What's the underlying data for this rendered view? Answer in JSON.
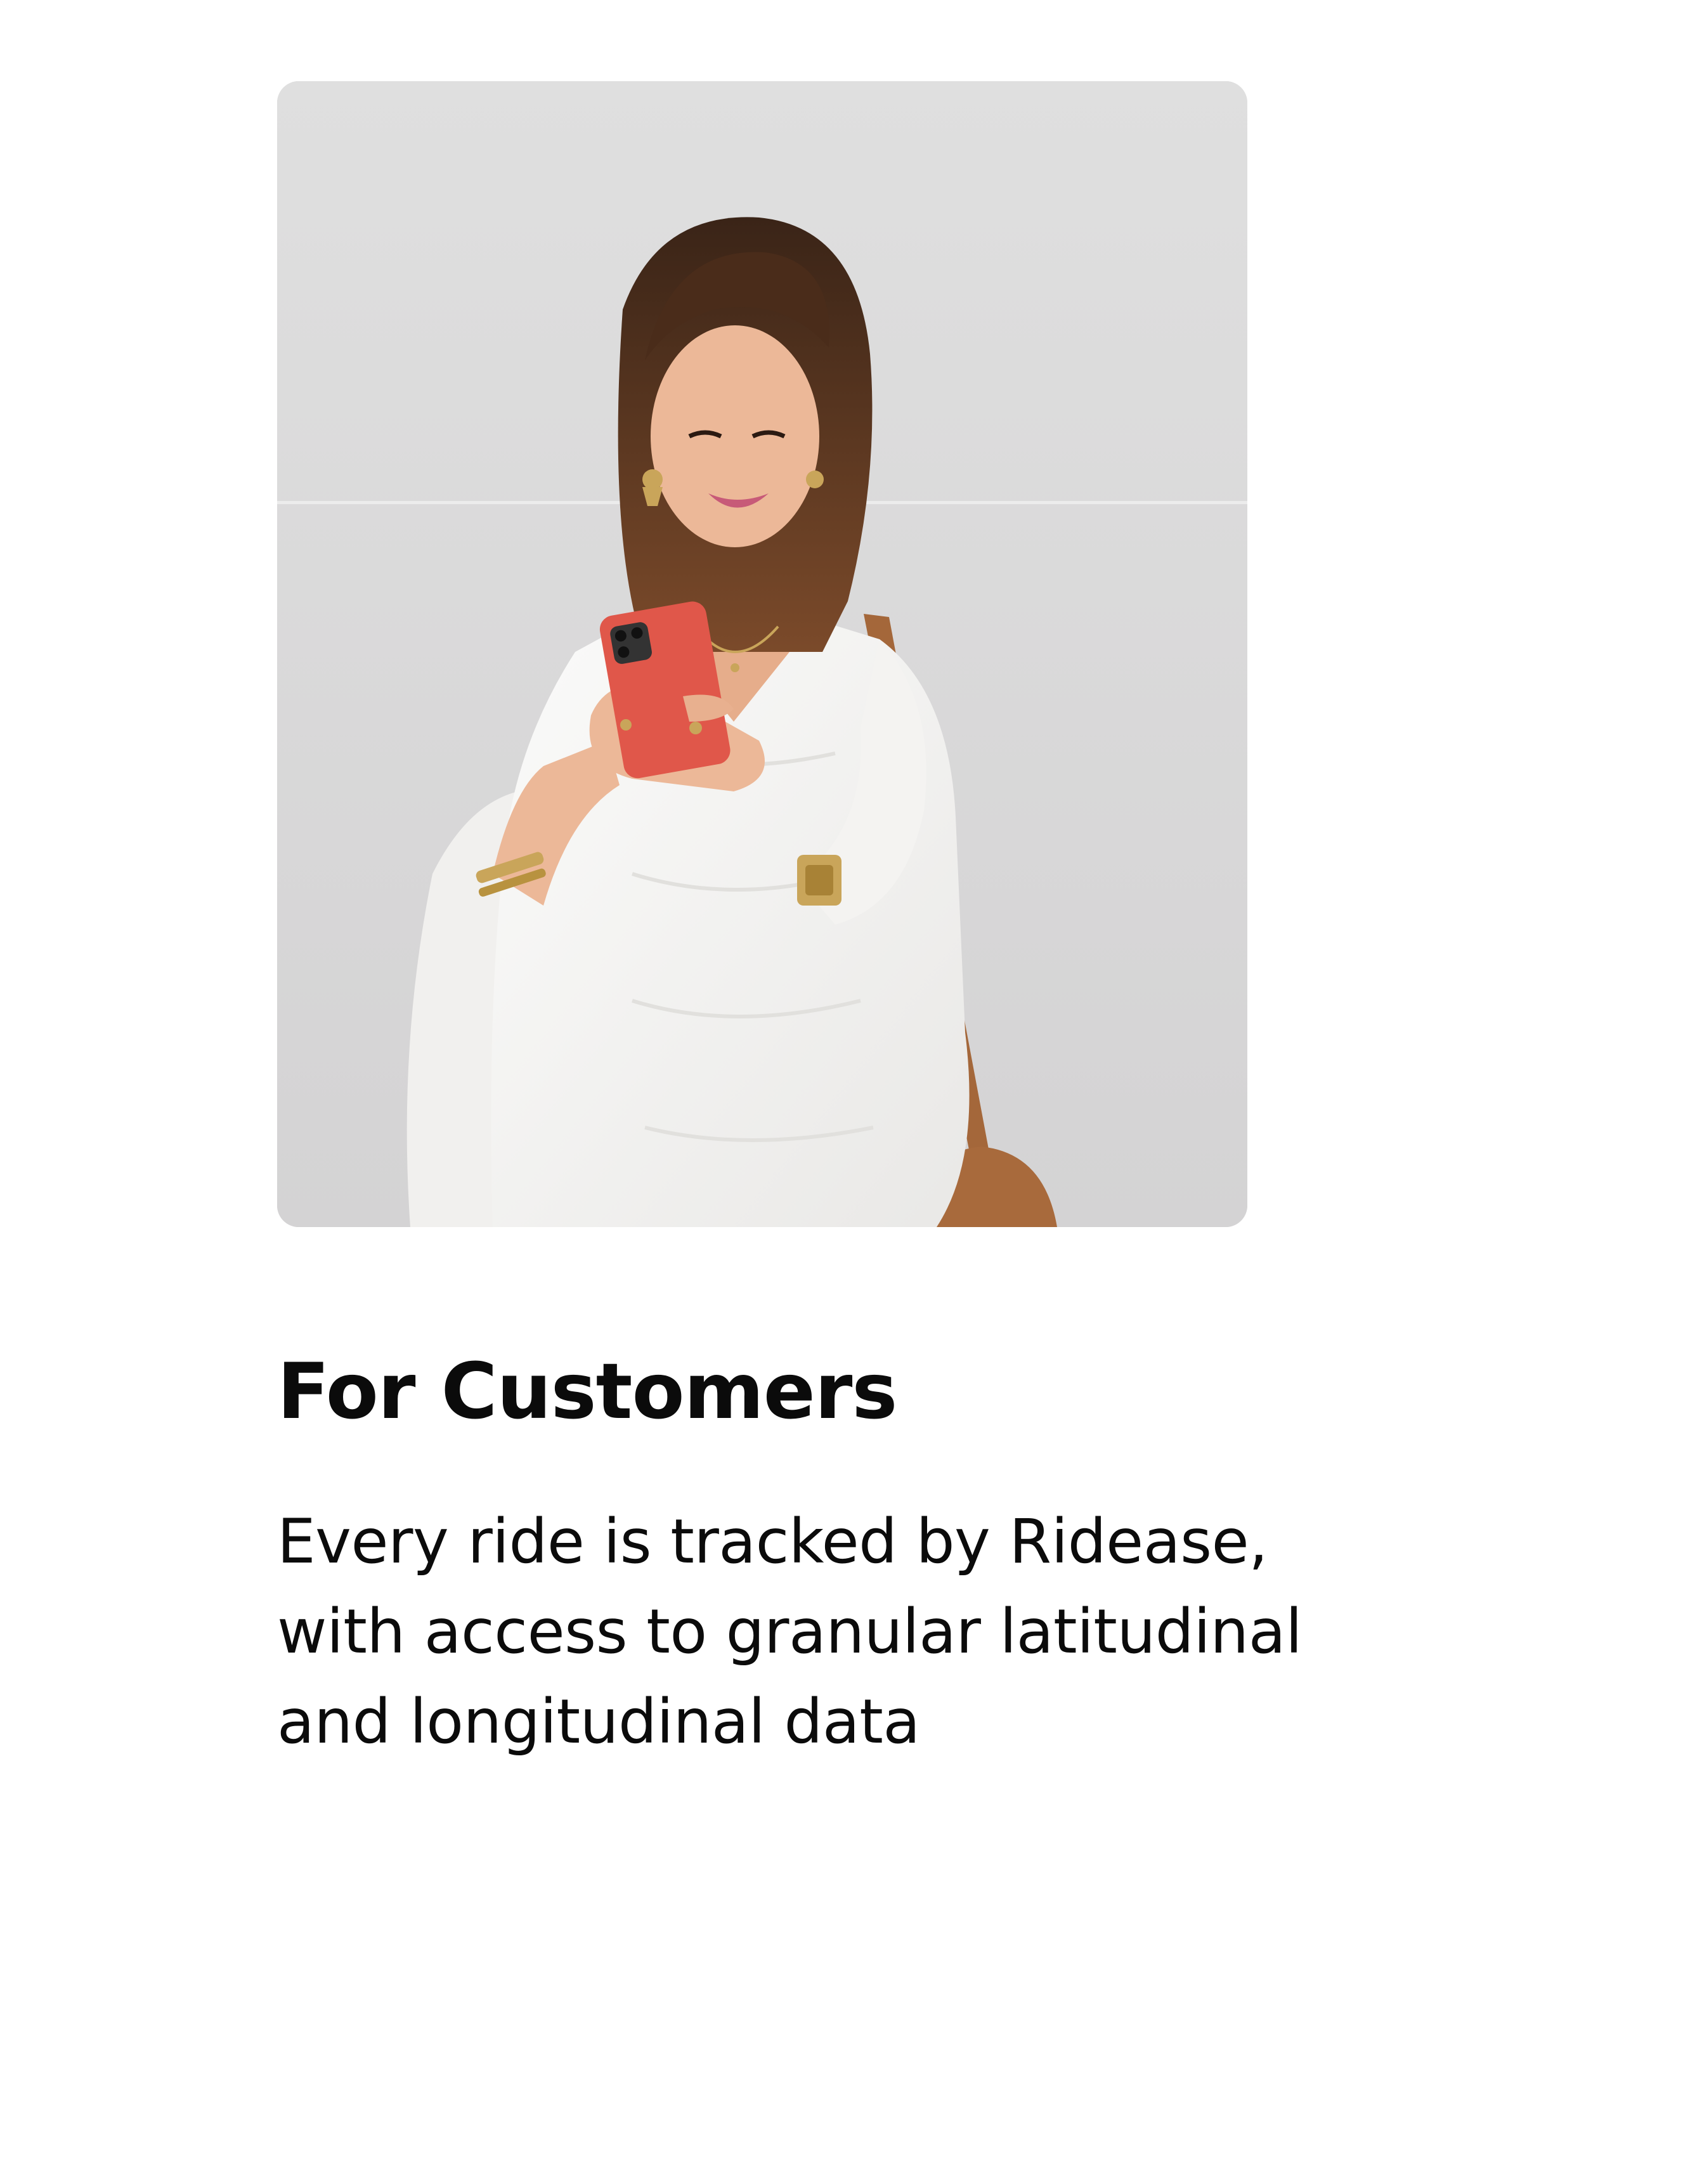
{
  "card": {
    "image_alt": "Smiling woman in white outfit looking at a red phone",
    "title": "For Customers",
    "description_lines": [
      "Every ride is tracked by Ridease,",
      "with access to granular latitudinal",
      "and longitudinal data"
    ]
  },
  "colors": {
    "background": "#ffffff",
    "text": "#0b0b0b",
    "photo_background": "#d9d8d8",
    "phone": "#e0574a",
    "bag_strap": "#a4673a"
  }
}
